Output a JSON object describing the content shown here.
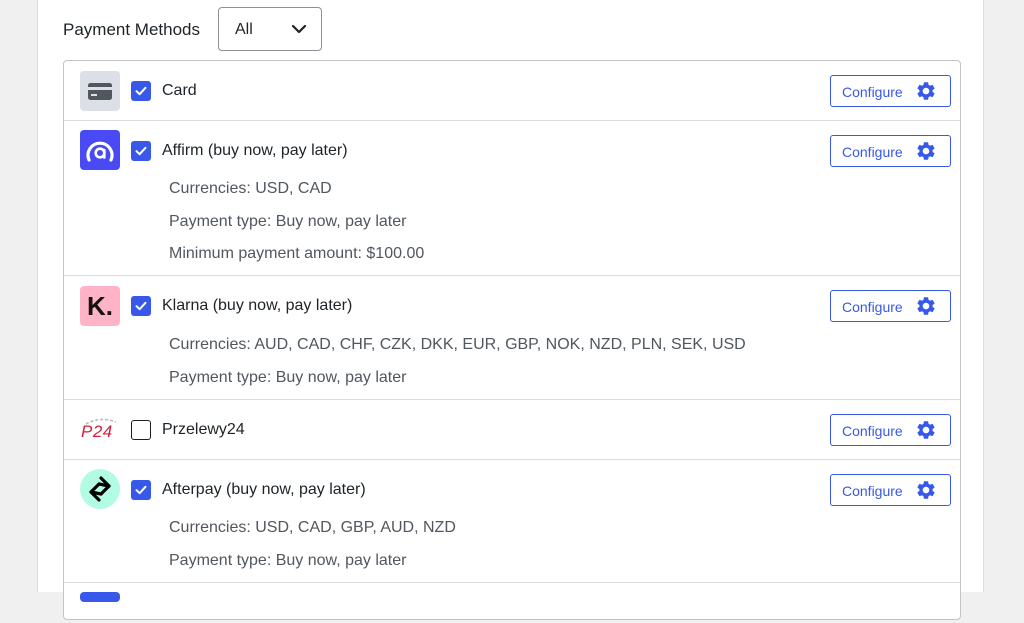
{
  "header": {
    "label": "Payment Methods",
    "filter": {
      "selected": "All"
    }
  },
  "configure_label": "Configure",
  "methods": [
    {
      "name": "Card",
      "checked": true,
      "icon": "card-icon",
      "details": []
    },
    {
      "name": "Affirm (buy now, pay later)",
      "checked": true,
      "icon": "affirm-logo",
      "details": [
        "Currencies: USD, CAD",
        "Payment type: Buy now, pay later",
        "Minimum payment amount: $100.00"
      ]
    },
    {
      "name": "Klarna (buy now, pay later)",
      "checked": true,
      "icon": "klarna-logo",
      "logo_text": "K.",
      "details": [
        "Currencies: AUD, CAD, CHF, CZK, DKK, EUR, GBP, NOK, NZD, PLN, SEK, USD",
        "Payment type: Buy now, pay later"
      ]
    },
    {
      "name": "Przelewy24",
      "checked": false,
      "icon": "p24-logo",
      "logo_text": "P24",
      "details": []
    },
    {
      "name": "Afterpay (buy now, pay later)",
      "checked": true,
      "icon": "afterpay-logo",
      "details": [
        "Currencies: USD, CAD, GBP, AUD, NZD",
        "Payment type: Buy now, pay later"
      ]
    }
  ],
  "colors": {
    "accent": "#3858e9",
    "affirm": "#4a4af4",
    "klarna": "#ffb3c7",
    "afterpay": "#b2fce4",
    "card_bg": "#dcdfe6"
  }
}
